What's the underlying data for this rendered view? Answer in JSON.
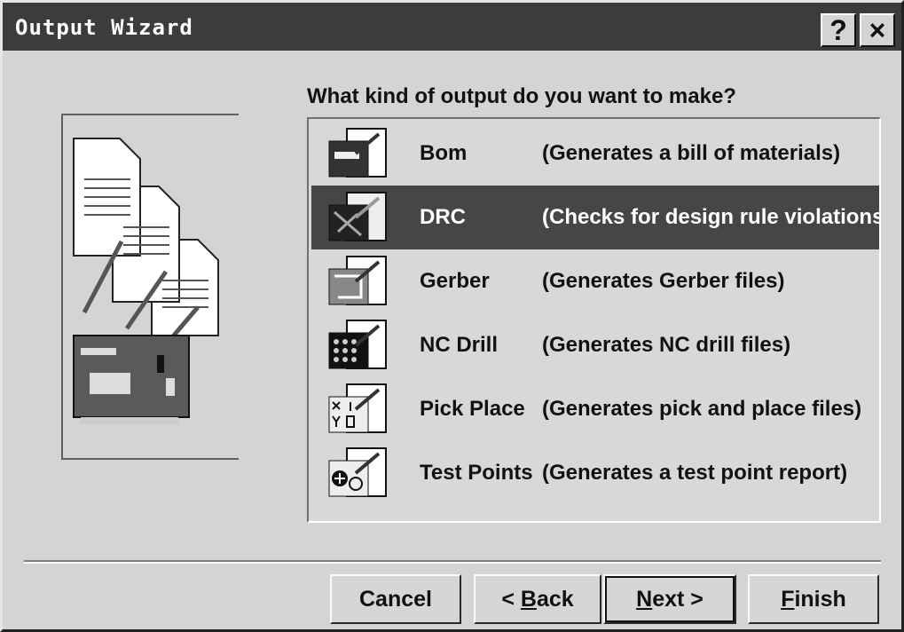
{
  "window": {
    "title": "Output Wizard",
    "help_label": "?",
    "close_label": "×"
  },
  "prompt": "What kind of output do you want to make?",
  "options": [
    {
      "name": "Bom",
      "desc": "(Generates a bill of materials)",
      "icon": "bom-icon",
      "selected": false
    },
    {
      "name": "DRC",
      "desc": "(Checks for design rule violations)",
      "icon": "drc-icon",
      "selected": true
    },
    {
      "name": "Gerber",
      "desc": "(Generates Gerber files)",
      "icon": "gerber-icon",
      "selected": false
    },
    {
      "name": "NC Drill",
      "desc": "(Generates NC drill files)",
      "icon": "nc-drill-icon",
      "selected": false
    },
    {
      "name": "Pick Place",
      "desc": "(Generates pick and place files)",
      "icon": "pick-place-icon",
      "selected": false
    },
    {
      "name": "Test Points",
      "desc": "(Generates a test point report)",
      "icon": "test-points-icon",
      "selected": false
    }
  ],
  "buttons": {
    "cancel": "Cancel",
    "back_prefix": "< ",
    "back_key": "B",
    "back_rest": "ack",
    "next_key": "N",
    "next_rest": "ext >",
    "finish_key": "F",
    "finish_rest": "inish"
  }
}
